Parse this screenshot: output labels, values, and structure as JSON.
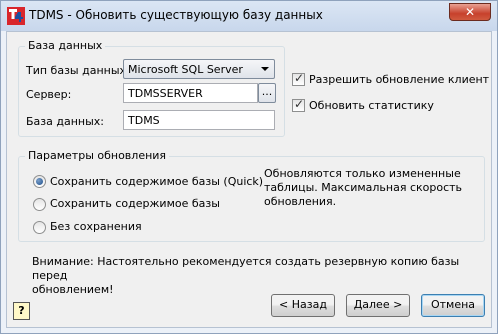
{
  "window": {
    "title": "TDMS - Обновить существующую базу данных",
    "close_glyph": "✕"
  },
  "database_group": {
    "title": "База данных",
    "db_type_label": "Тип базы данных:",
    "db_type_value": "Microsoft SQL Server",
    "server_label": "Сервер:",
    "server_value": "TDMSSERVER",
    "browse_label": "...",
    "db_name_label": "База данных:",
    "db_name_value": "TDMS"
  },
  "options": {
    "allow_client_update_label": "Разрешить обновление клиентов г",
    "allow_client_update_checked": true,
    "update_stats_label": "Обновить статистику",
    "update_stats_checked": true
  },
  "update_group": {
    "title": "Параметры обновления",
    "radios": [
      {
        "label": "Сохранить содержимое базы (Quick)",
        "selected": true
      },
      {
        "label": "Сохранить содержимое базы",
        "selected": false
      },
      {
        "label": "Без сохранения",
        "selected": false
      }
    ],
    "description_lines": [
      "Обновляются только измененные",
      "таблицы. Максимальная скорость",
      "обновления."
    ]
  },
  "warning_lines": [
    "Внимание: Настоятельно рекомендуется создать резервную копию базы перед",
    "обновлением!"
  ],
  "buttons": {
    "help": "?",
    "back": "< Назад",
    "next": "Далее >",
    "cancel": "Отмена"
  },
  "colors": {
    "title_bar": "#c8d7ec",
    "close_button": "#c7412c",
    "app_icon_red": "#d9262b",
    "app_icon_blue": "#1c4fa0"
  }
}
